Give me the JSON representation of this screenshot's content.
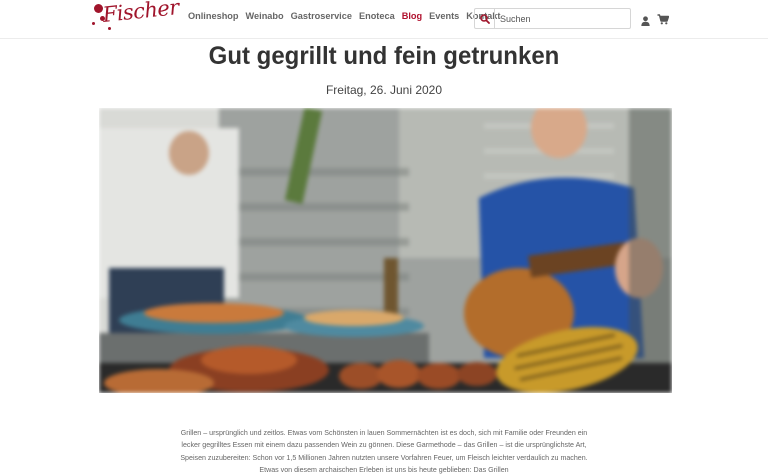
{
  "brand": {
    "logo_text": "Fischer",
    "accent_color": "#a0142b"
  },
  "nav": {
    "items": [
      {
        "label": "Onlineshop",
        "active": false
      },
      {
        "label": "Weinabo",
        "active": false
      },
      {
        "label": "Gastroservice",
        "active": false
      },
      {
        "label": "Enoteca",
        "active": false
      },
      {
        "label": "Blog",
        "active": true
      },
      {
        "label": "Events",
        "active": false
      },
      {
        "label": "Kontakt",
        "active": false
      }
    ]
  },
  "search": {
    "placeholder": "Suchen",
    "icon": "search-icon"
  },
  "header_icons": {
    "account": "user-icon",
    "cart": "cart-icon"
  },
  "article": {
    "title": "Gut gegrillt und fein getrunken",
    "date": "Freitag, 26. Juni 2020",
    "paragraph": "Grillen – ursprünglich und zeitlos. Etwas vom Schönsten in lauen Sommernächten ist es doch, sich mit Familie oder Freunden ein lecker gegrilltes Essen mit einem dazu passenden Wein zu gönnen. Diese Garmethode – das Grillen – ist die ursprünglichste Art, Speisen zuzubereiten: Schon vor 1,5 Millionen Jahren nutzten unsere Vorfahren Feuer, um Fleisch leichter verdaulich zu machen. Etwas von diesem archaischen Erleben ist uns bis heute geblieben: Das Grillen"
  }
}
